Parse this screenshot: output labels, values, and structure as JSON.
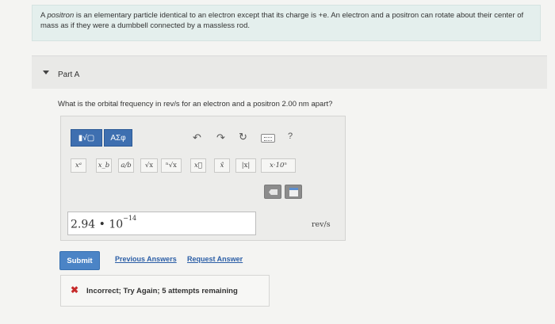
{
  "intro": {
    "part1": "A ",
    "positron_word": "positron",
    "part2": " is an elementary particle identical to an electron except that its charge is +e. An electron and a positron can rotate about their center of mass as if they were a dumbbell connected by a massless rod."
  },
  "part": {
    "label": "Part A"
  },
  "question": "What is the orbital frequency in rev/s for an electron and a positron 2.00 nm apart?",
  "toolbar": {
    "templates_label": "▮√▢",
    "greek_label": "ΑΣφ",
    "help_label": "?",
    "undo_glyph": "↶",
    "redo_glyph": "↷",
    "reset_glyph": "↻"
  },
  "symbols": [
    "xᵃ",
    "x_b",
    "a/b",
    "√x",
    "ⁿ√x",
    "x⃗",
    "x̂",
    "|x|",
    "x·10ⁿ"
  ],
  "answer": {
    "mantissa": "2.94 • 10",
    "exponent": "−14"
  },
  "unit": "rev/s",
  "actions": {
    "submit": "Submit",
    "previous_answers": "Previous Answers",
    "request_answer": "Request Answer"
  },
  "feedback": {
    "icon": "✖",
    "message": "Incorrect; Try Again; 5 attempts remaining"
  },
  "colors": {
    "accent": "#4b84c6",
    "error": "#c62a2a",
    "intro_bg": "#e4efed"
  }
}
